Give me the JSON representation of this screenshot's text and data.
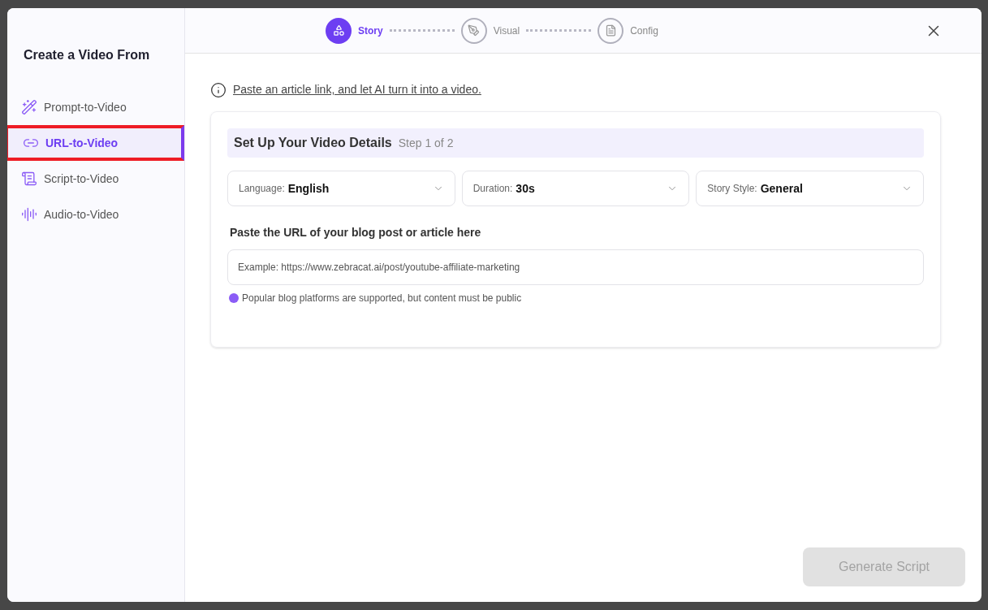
{
  "sidebar": {
    "title": "Create a Video From",
    "items": [
      {
        "kind": "wand",
        "label": "Prompt-to-Video",
        "selected": false
      },
      {
        "kind": "link",
        "label": "URL-to-Video",
        "selected": true
      },
      {
        "kind": "scroll",
        "label": "Script-to-Video",
        "selected": false
      },
      {
        "kind": "audio",
        "label": "Audio-to-Video",
        "selected": false
      }
    ]
  },
  "steps": [
    {
      "kind": "story",
      "label": "Story",
      "selected": true
    },
    {
      "kind": "visual",
      "label": "Visual",
      "selected": false
    },
    {
      "kind": "config",
      "label": "Config",
      "selected": false
    }
  ],
  "hint_link": "Paste an article link, and let AI turn it into a video.",
  "card": {
    "title": "Set Up Your Video Details",
    "step": "Step 1 of 2",
    "selects": [
      {
        "label": "Language:",
        "value": "English"
      },
      {
        "label": "Duration:",
        "value": "30s"
      },
      {
        "label": "Story Style:",
        "value": "General"
      }
    ],
    "url_label": "Paste the URL of your blog post or article here",
    "url_placeholder": "Example: https://www.zebracat.ai/post/youtube-affiliate-marketing",
    "note": "Popular blog platforms are supported, but content must be public"
  },
  "generate_button": {
    "label": "Generate Script",
    "disabled": true
  }
}
